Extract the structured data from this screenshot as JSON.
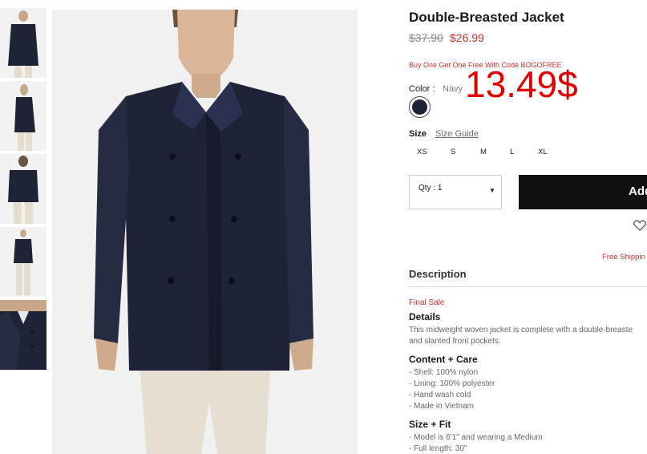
{
  "product": {
    "title": "Double-Breasted Jacket",
    "old_price": "$37.90",
    "new_price": "$26.99",
    "promo": "Buy One Get One Free With Code BOGOFREE",
    "overlay_price": "13.49$"
  },
  "color": {
    "label": "Color :",
    "value": "Navy",
    "swatch_hex": "#1e2336"
  },
  "size": {
    "label": "Size",
    "guide": "Size Guide",
    "options": [
      "XS",
      "S",
      "M",
      "L",
      "XL"
    ]
  },
  "quantity": {
    "label": "Qty : 1"
  },
  "buttons": {
    "add": "Add"
  },
  "shipping": {
    "text": "Free Shippin"
  },
  "description": {
    "title": "Description",
    "final_sale": "Final Sale",
    "details_title": "Details",
    "details_lines": [
      "This midweight woven jacket is complete with a double-breaste",
      "and slanted front pockets."
    ],
    "content_title": "Content + Care",
    "content_items": [
      "- Shell: 100% nylon",
      "- Lining: 100% polyester",
      "- Hand wash cold",
      "- Made in Vietnam"
    ],
    "fit_title": "Size + Fit",
    "fit_items": [
      "- Model is 6'1\" and wearing a Medium",
      "- Full length: 30\""
    ]
  },
  "colors": {
    "accent_red": "#d0312d",
    "button_black": "#111111",
    "jacket_navy": "#1e2336"
  }
}
